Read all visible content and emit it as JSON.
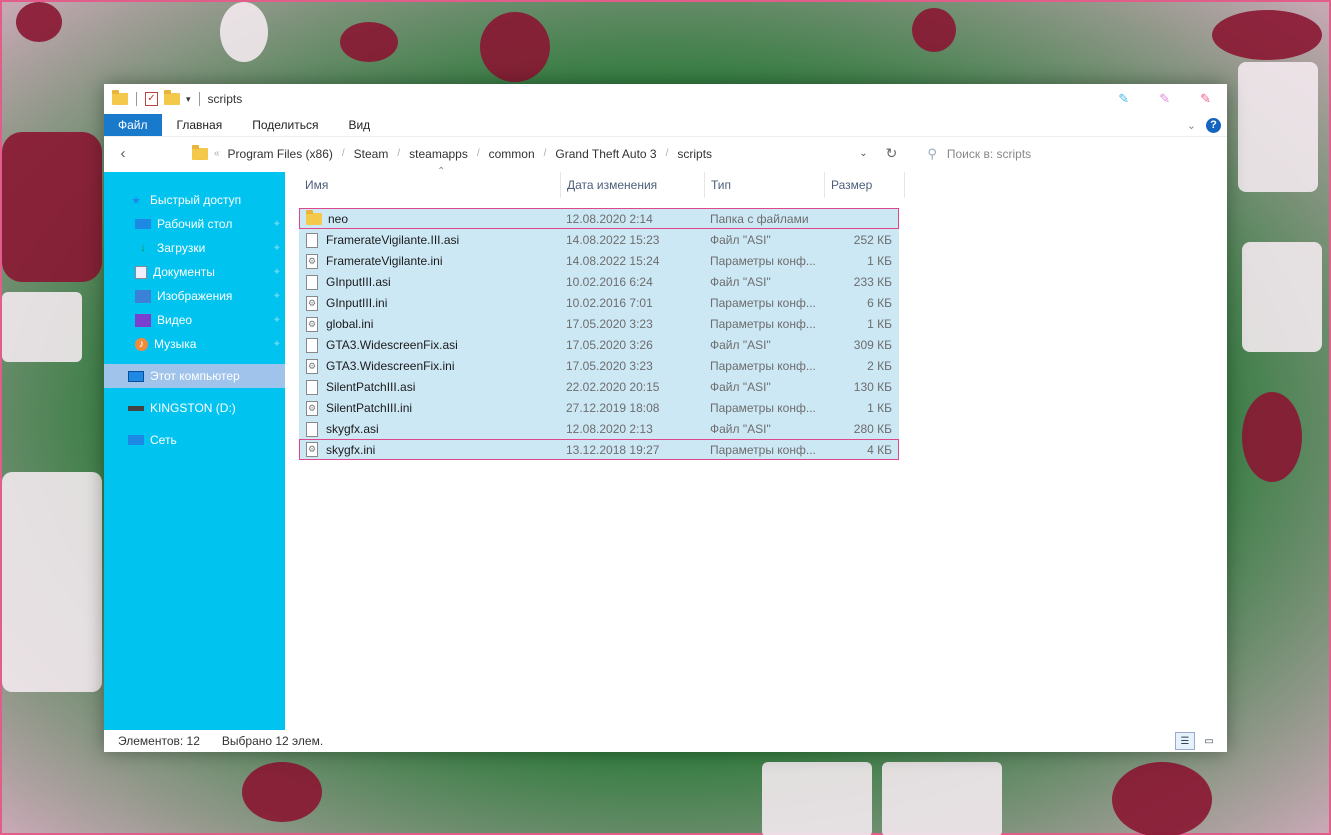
{
  "window": {
    "title": "scripts"
  },
  "ribbon": {
    "tabs": [
      "Файл",
      "Главная",
      "Поделиться",
      "Вид"
    ]
  },
  "address": {
    "crumbs": [
      "Program Files (x86)",
      "Steam",
      "steamapps",
      "common",
      "Grand Theft Auto 3",
      "scripts"
    ],
    "search_placeholder": "Поиск в: scripts"
  },
  "sidebar": {
    "items": [
      {
        "label": "Быстрый доступ",
        "icon": "star-icon",
        "pinned": false
      },
      {
        "label": "Рабочий стол",
        "icon": "desktop-icon",
        "pinned": true
      },
      {
        "label": "Загрузки",
        "icon": "download-icon",
        "pinned": true
      },
      {
        "label": "Документы",
        "icon": "documents-icon",
        "pinned": true
      },
      {
        "label": "Изображения",
        "icon": "pictures-icon",
        "pinned": true
      },
      {
        "label": "Видео",
        "icon": "video-icon",
        "pinned": true
      },
      {
        "label": "Музыка",
        "icon": "music-icon",
        "pinned": true
      },
      {
        "label": "Этот компьютер",
        "icon": "computer-icon",
        "selected": true
      },
      {
        "label": "KINGSTON (D:)",
        "icon": "drive-icon"
      },
      {
        "label": "Сеть",
        "icon": "network-icon"
      }
    ]
  },
  "columns": {
    "name": "Имя",
    "date": "Дата изменения",
    "type": "Тип",
    "size": "Размер"
  },
  "files": [
    {
      "name": "neo",
      "date": "12.08.2020 2:14",
      "type": "Папка с файлами",
      "size": "",
      "kind": "folder"
    },
    {
      "name": "FramerateVigilante.III.asi",
      "date": "14.08.2022 15:23",
      "type": "Файл \"ASI\"",
      "size": "252 КБ",
      "kind": "file"
    },
    {
      "name": "FramerateVigilante.ini",
      "date": "14.08.2022 15:24",
      "type": "Параметры конф...",
      "size": "1 КБ",
      "kind": "cfg"
    },
    {
      "name": "GInputIII.asi",
      "date": "10.02.2016 6:24",
      "type": "Файл \"ASI\"",
      "size": "233 КБ",
      "kind": "file"
    },
    {
      "name": "GInputIII.ini",
      "date": "10.02.2016 7:01",
      "type": "Параметры конф...",
      "size": "6 КБ",
      "kind": "cfg"
    },
    {
      "name": "global.ini",
      "date": "17.05.2020 3:23",
      "type": "Параметры конф...",
      "size": "1 КБ",
      "kind": "cfg"
    },
    {
      "name": "GTA3.WidescreenFix.asi",
      "date": "17.05.2020 3:26",
      "type": "Файл \"ASI\"",
      "size": "309 КБ",
      "kind": "file"
    },
    {
      "name": "GTA3.WidescreenFix.ini",
      "date": "17.05.2020 3:23",
      "type": "Параметры конф...",
      "size": "2 КБ",
      "kind": "cfg"
    },
    {
      "name": "SilentPatchIII.asi",
      "date": "22.02.2020 20:15",
      "type": "Файл \"ASI\"",
      "size": "130 КБ",
      "kind": "file"
    },
    {
      "name": "SilentPatchIII.ini",
      "date": "27.12.2019 18:08",
      "type": "Параметры конф...",
      "size": "1 КБ",
      "kind": "cfg"
    },
    {
      "name": "skygfx.asi",
      "date": "12.08.2020 2:13",
      "type": "Файл \"ASI\"",
      "size": "280 КБ",
      "kind": "file"
    },
    {
      "name": "skygfx.ini",
      "date": "13.12.2018 19:27",
      "type": "Параметры конф...",
      "size": "4 КБ",
      "kind": "cfg"
    }
  ],
  "status": {
    "count": "Элементов: 12",
    "selected": "Выбрано 12 элем."
  },
  "colors": {
    "sidebar": "#00c3f0",
    "accent": "#1979ca",
    "selection": "#cde8f5",
    "highlight_border": "#e0478a"
  }
}
